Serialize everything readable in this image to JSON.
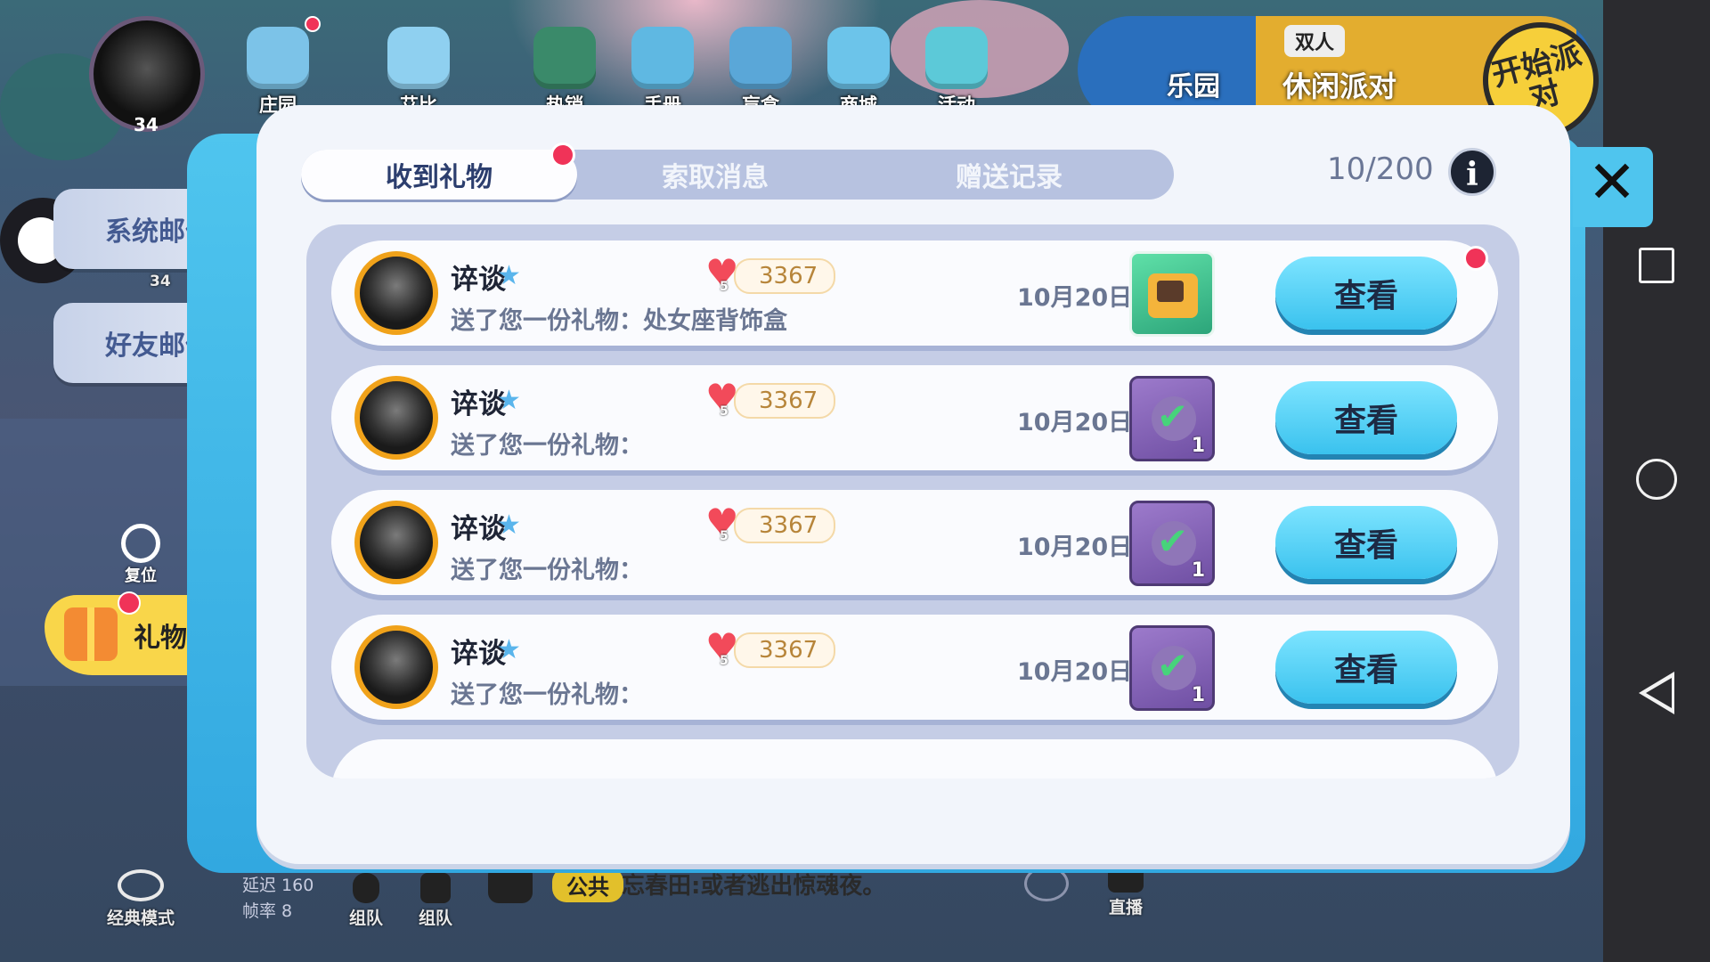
{
  "hud": {
    "level": "34",
    "left_level": "34",
    "nav": [
      {
        "label": "庄园",
        "icon": "house-icon"
      },
      {
        "label": "艾比",
        "icon": "cat-mascot-icon"
      },
      {
        "label": "热销",
        "icon": "hot-sale-icon"
      },
      {
        "label": "手册",
        "icon": "handbook-icon"
      },
      {
        "label": "盲盒",
        "icon": "blind-box-icon"
      },
      {
        "label": "商城",
        "icon": "shop-bag-icon"
      },
      {
        "label": "活动",
        "icon": "activity-icon"
      }
    ],
    "park_label": "乐园",
    "duo_label": "双人",
    "party_label": "休闲派对",
    "start_label": "开始派对"
  },
  "side": {
    "system_mail": "系统邮件",
    "friend_mail": "好友邮件",
    "reset_label": "复位",
    "gift_center": "礼物中心"
  },
  "bottom": {
    "mode_label": "经典模式",
    "latency": "延迟 160",
    "fps": "帧率 8",
    "team_voice_1": "组队",
    "team_voice_2": "组队",
    "channel_tag": "公共",
    "chat_message": "忘春田:或者逃出惊魂夜。",
    "live_label": "直播"
  },
  "panel": {
    "tabs": [
      {
        "label": "收到礼物",
        "active": true
      },
      {
        "label": "索取消息",
        "active": false
      },
      {
        "label": "赠送记录",
        "active": false
      }
    ],
    "counter": "10/200",
    "info_symbol": "i",
    "close_symbol": "✕",
    "rows": [
      {
        "name": "谇谈",
        "hearts_level": "5",
        "points": "3367",
        "message": "送了您一份礼物：处女座背饰盒",
        "date": "10月20日",
        "item": "gift-box-icon",
        "qty": "",
        "button": "查看"
      },
      {
        "name": "谇谈",
        "hearts_level": "5",
        "points": "3367",
        "message": "送了您一份礼物：",
        "date": "10月20日",
        "item": "claimed-check-icon",
        "qty": "1",
        "button": "查看"
      },
      {
        "name": "谇谈",
        "hearts_level": "5",
        "points": "3367",
        "message": "送了您一份礼物：",
        "date": "10月20日",
        "item": "claimed-check-icon",
        "qty": "1",
        "button": "查看"
      },
      {
        "name": "谇谈",
        "hearts_level": "5",
        "points": "3367",
        "message": "送了您一份礼物：",
        "date": "10月20日",
        "item": "claimed-check-icon",
        "qty": "1",
        "button": "查看"
      }
    ]
  },
  "colors": {
    "accent_red": "#f03358",
    "button_blue": "#3ac2ee",
    "frame_blue": "#4fc5ee",
    "heart": "#f24a5a"
  }
}
